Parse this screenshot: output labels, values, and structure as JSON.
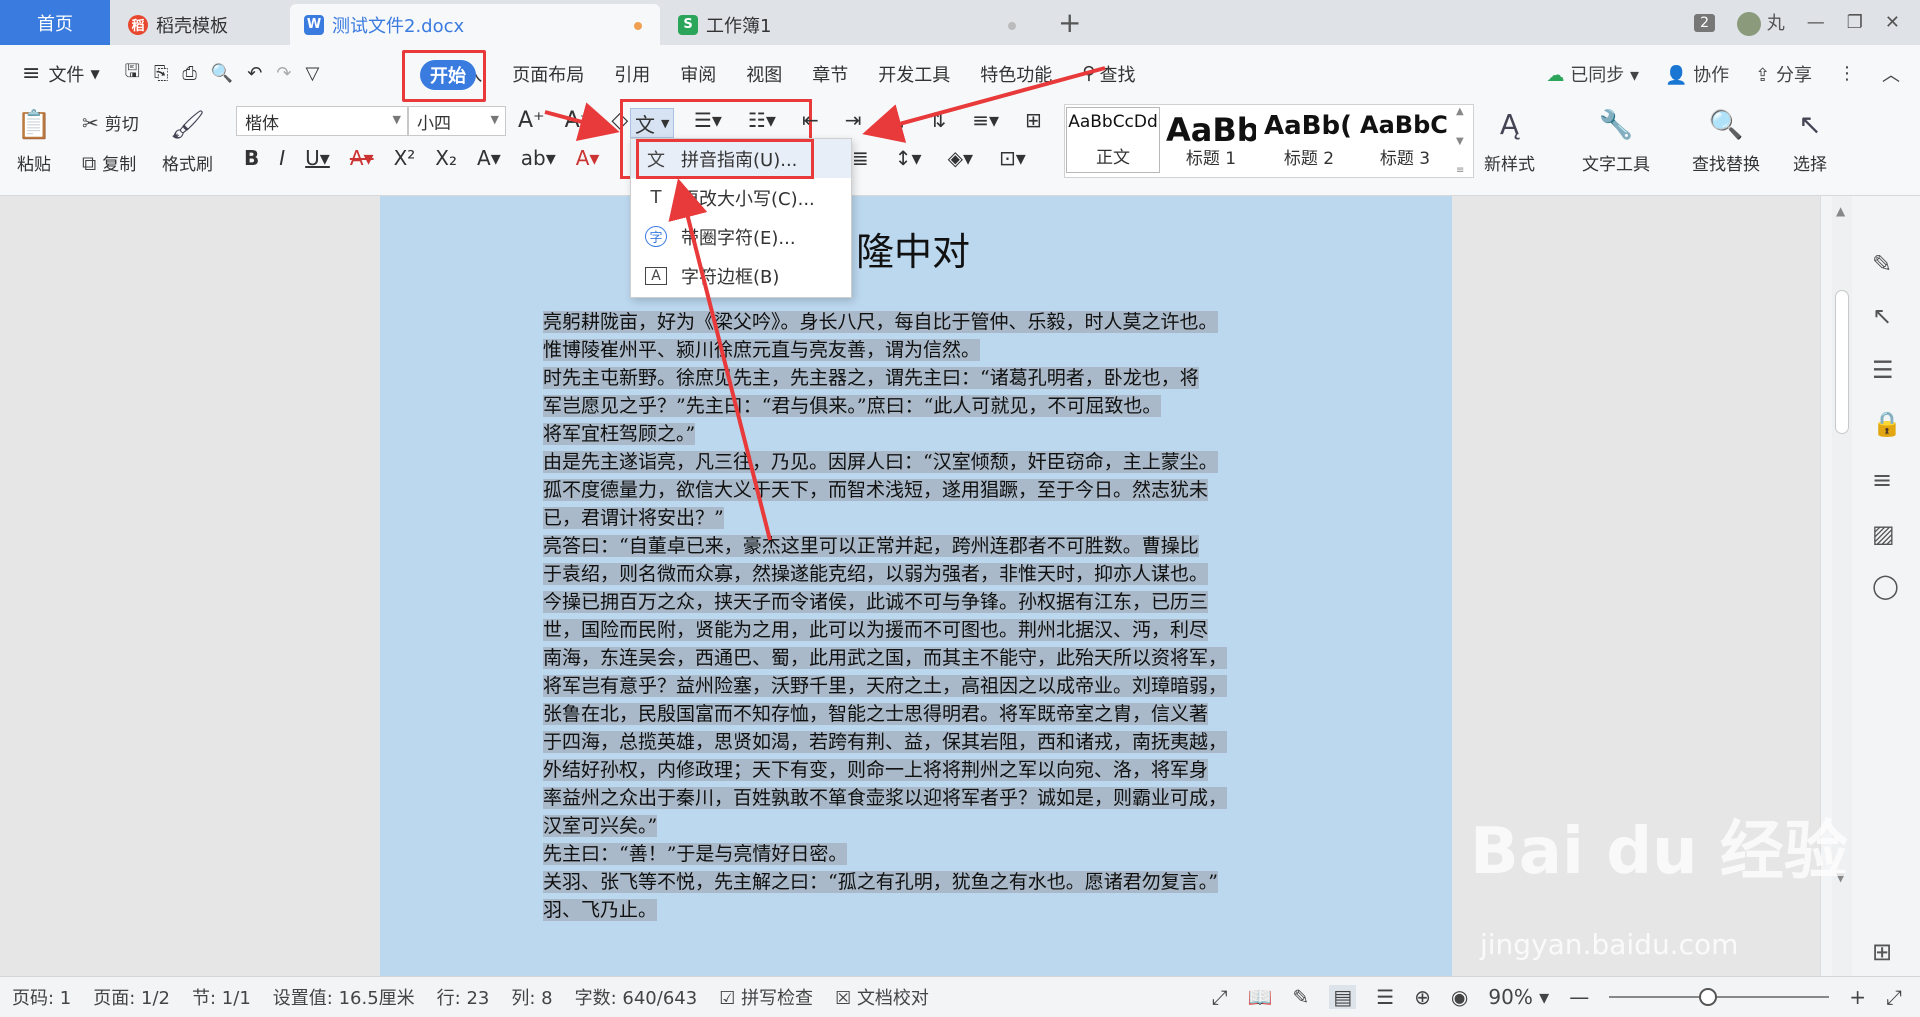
{
  "tabs": {
    "home": "首页",
    "daoke": "稻壳模板",
    "doc": "测试文件2.docx",
    "xls": "工作簿1",
    "count": "2",
    "user": "丸"
  },
  "menu": {
    "file": "文件",
    "start": "开始",
    "items": [
      "插入",
      "页面布局",
      "引用",
      "审阅",
      "视图",
      "章节",
      "开发工具",
      "特色功能"
    ],
    "search": "查找",
    "synced": "已同步",
    "collab": "协作",
    "share": "分享"
  },
  "ribbon": {
    "paste": "粘贴",
    "cut": "剪切",
    "copy": "复制",
    "format_painter": "格式刷",
    "font": "楷体",
    "size": "小四",
    "styles": [
      {
        "preview": "AaBbCcDd",
        "label": "正文"
      },
      {
        "preview": "AaBb",
        "label": "标题 1"
      },
      {
        "preview": "AaBb(",
        "label": "标题 2"
      },
      {
        "preview": "AaBbC(",
        "label": "标题 3"
      }
    ],
    "new_style": "新样式",
    "text_tools": "文字工具",
    "find_replace": "查找替换",
    "select": "选择"
  },
  "dropdown": {
    "items": [
      {
        "icon": "文",
        "label": "拼音指南(U)..."
      },
      {
        "icon": "T",
        "label": "更改大小写(C)..."
      },
      {
        "icon": "字",
        "label": "带圈字符(E)..."
      },
      {
        "icon": "A",
        "label": "字符边框(B)"
      }
    ]
  },
  "document": {
    "title": "隆中对",
    "lines": [
      "亮躬耕陇亩，好为《梁父吟》。身长八尺，每自比于管仲、乐毅，时人莫之许也。",
      "惟博陵崔州平、颍川徐庶元直与亮友善，谓为信然。",
      "时先主屯新野。徐庶见先主，先主器之，谓先主曰：“诸葛孔明者，卧龙也，将",
      "军岂愿见之乎？”先主曰：“君与俱来。”庶曰：“此人可就见，不可屈致也。",
      "将军宜枉驾顾之。”",
      "由是先主遂诣亮，凡三往，乃见。因屏人曰：“汉室倾颓，奸臣窃命，主上蒙尘。",
      "孤不度德量力，欲信大义于天下，而智术浅短，遂用猖蹶，至于今日。然志犹未",
      "已，君谓计将安出？”",
      "亮答曰：“自董卓已来，豪杰这里可以正常并起，跨州连郡者不可胜数。曹操比",
      "于袁绍，则名微而众寡，然操遂能克绍，以弱为强者，非惟天时，抑亦人谋也。",
      "今操已拥百万之众，挟天子而令诸侯，此诚不可与争锋。孙权据有江东，已历三",
      "世，国险而民附，贤能为之用，此可以为援而不可图也。荆州北据汉、沔，利尽",
      "南海，东连吴会，西通巴、蜀，此用武之国，而其主不能守，此殆天所以资将军，",
      "将军岂有意乎？益州险塞，沃野千里，天府之土，高祖因之以成帝业。刘璋暗弱，",
      "张鲁在北，民殷国富而不知存恤，智能之士思得明君。将军既帝室之胄，信义著",
      "于四海，总揽英雄，思贤如渴，若跨有荆、益，保其岩阻，西和诸戎，南抚夷越，",
      "外结好孙权，内修政理；天下有变，则命一上将将荆州之军以向宛、洛，将军身",
      "率益州之众出于秦川，百姓孰敢不箪食壶浆以迎将军者乎？诚如是，则霸业可成，",
      "汉室可兴矣。”",
      "先主曰：“善！”于是与亮情好日密。",
      "关羽、张飞等不悦，先主解之曰：“孤之有孔明，犹鱼之有水也。愿诸君勿复言。”",
      "羽、飞乃止。"
    ]
  },
  "status": {
    "page_num": "页码: 1",
    "page": "页面: 1/2",
    "section": "节: 1/1",
    "setting": "设置值: 16.5厘米",
    "row": "行: 23",
    "col": "列: 8",
    "words": "字数: 640/643",
    "spell": "拼写检查",
    "proof": "文档校对",
    "zoom": "90%",
    "zoom_level": 0.45
  },
  "watermark": {
    "main": "Bai du 经验",
    "sub": "jingyan.baidu.com"
  },
  "colors": {
    "accent": "#3a7be0",
    "highlight": "#e83a3a",
    "page": "#bcd8ef"
  }
}
